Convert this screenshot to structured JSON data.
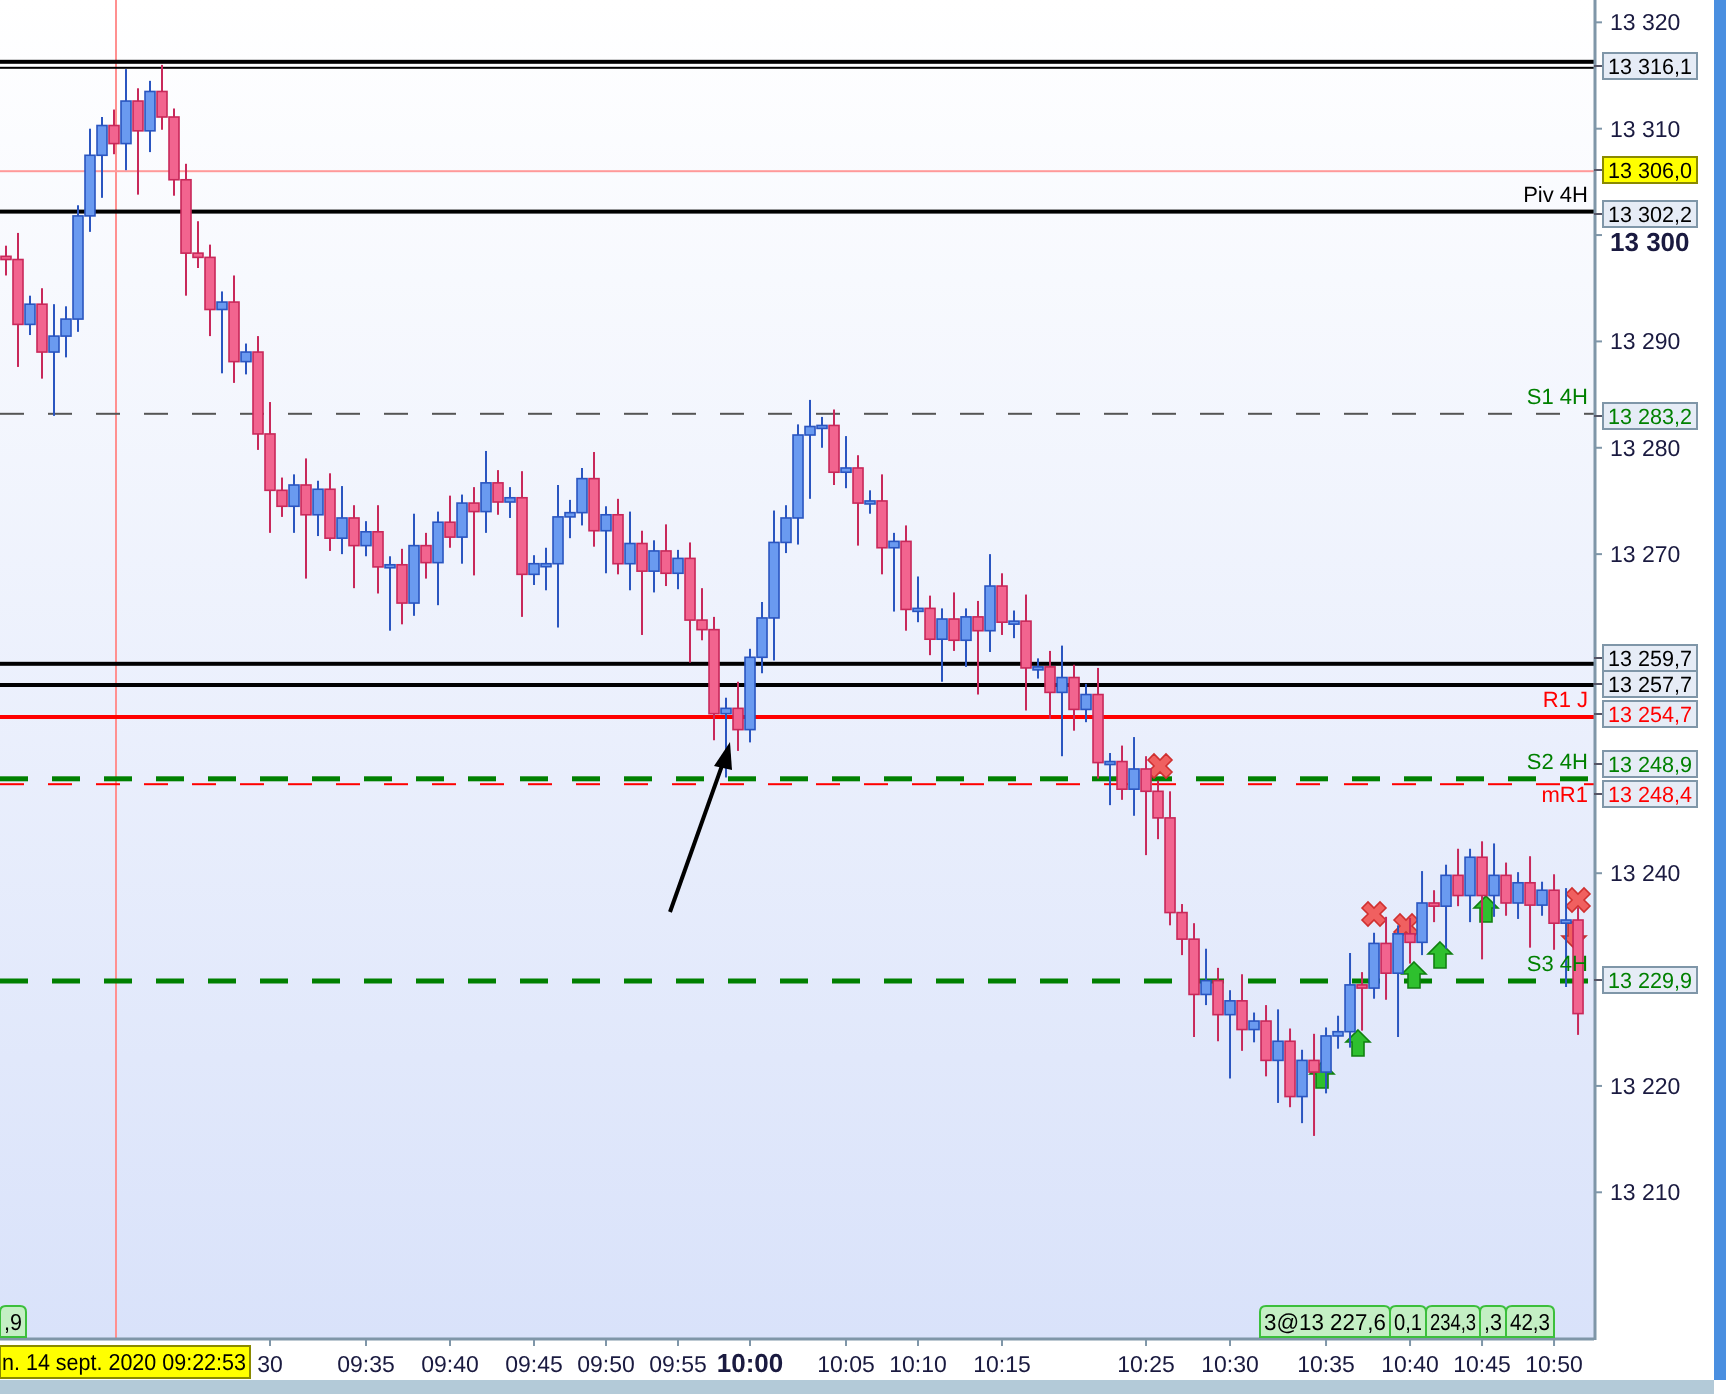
{
  "chart_data": {
    "type": "candlestick",
    "ylim": [
      13196.3,
      13322.1
    ],
    "yticks": [
      {
        "value": 13320,
        "label": "13 320"
      },
      {
        "value": 13310,
        "label": "13 310"
      },
      {
        "value": 13300,
        "label": "13 300"
      },
      {
        "value": 13290,
        "label": "13 290"
      },
      {
        "value": 13280,
        "label": "13 280"
      },
      {
        "value": 13270,
        "label": "13 270"
      },
      {
        "value": 13240,
        "label": "13 240"
      },
      {
        "value": 13220,
        "label": "13 220"
      },
      {
        "value": 13210,
        "label": "13 210"
      }
    ],
    "categories": [
      null,
      null,
      null,
      null,
      null,
      null,
      null,
      null,
      null,
      null,
      null,
      null,
      null,
      null,
      null,
      null,
      null,
      null,
      null,
      null,
      null,
      null,
      "30",
      null,
      null,
      null,
      null,
      null,
      null,
      null,
      "09:35",
      null,
      null,
      null,
      null,
      null,
      null,
      "09:40",
      null,
      null,
      null,
      null,
      null,
      null,
      "09:45",
      null,
      null,
      null,
      null,
      null,
      "09:50",
      null,
      null,
      null,
      null,
      null,
      "09:55",
      null,
      null,
      null,
      null,
      null,
      "10:00",
      null,
      null,
      null,
      null,
      null,
      null,
      null,
      "10:05",
      null,
      null,
      null,
      null,
      null,
      "10:10",
      null,
      null,
      null,
      null,
      null,
      null,
      "10:15",
      null,
      null,
      null,
      null,
      null,
      null,
      null,
      null,
      null,
      null,
      null,
      "10:25",
      null,
      null,
      null,
      null,
      null,
      null,
      "10:30",
      null,
      null,
      null,
      null,
      null,
      null,
      null,
      "10:35",
      null,
      null,
      null,
      null,
      null,
      null,
      "10:40",
      null,
      null,
      null,
      null,
      null,
      "10:45",
      null,
      null,
      null,
      null,
      null,
      "10:50",
      null,
      null
    ],
    "ohlc": [
      [
        13298,
        13299,
        13296.2,
        13297.7
      ],
      [
        13297.7,
        13300.2,
        13287.6,
        13291.6
      ],
      [
        13291.6,
        13294.3,
        13290.6,
        13293.5
      ],
      [
        13293.5,
        13295,
        13286.5,
        13289
      ],
      [
        13289,
        13293.5,
        13283,
        13290.5
      ],
      [
        13290.5,
        13293.3,
        13288.5,
        13292.1
      ],
      [
        13292.1,
        13302.8,
        13290.9,
        13301.8
      ],
      [
        13301.8,
        13310,
        13300.3,
        13307.5
      ],
      [
        13307.5,
        13311.1,
        13303.5,
        13310.3
      ],
      [
        13310.3,
        13311.8,
        13307.6,
        13308.6
      ],
      [
        13308.6,
        13315.6,
        13306.1,
        13312.6
      ],
      [
        13312.6,
        13313.8,
        13303.8,
        13309.8
      ],
      [
        13309.8,
        13314.5,
        13307.8,
        13313.5
      ],
      [
        13313.5,
        13316,
        13309.9,
        13311.1
      ],
      [
        13311.1,
        13311.9,
        13303.7,
        13305.2
      ],
      [
        13305.2,
        13306.7,
        13294.3,
        13298.3
      ],
      [
        13298.3,
        13301.3,
        13296.9,
        13297.9
      ],
      [
        13297.9,
        13299.1,
        13290.5,
        13293
      ],
      [
        13293,
        13294.7,
        13287,
        13293.7
      ],
      [
        13293.7,
        13296.2,
        13286.1,
        13288.1
      ],
      [
        13288.1,
        13289.8,
        13286.9,
        13289
      ],
      [
        13289,
        13290.5,
        13279.8,
        13281.3
      ],
      [
        13281.3,
        13284.3,
        13272,
        13276
      ],
      [
        13276,
        13277.2,
        13273.5,
        13274.5
      ],
      [
        13274.5,
        13277.5,
        13272,
        13276.5
      ],
      [
        13276.5,
        13279,
        13267.7,
        13273.7
      ],
      [
        13273.7,
        13276.9,
        13271.7,
        13276.1
      ],
      [
        13276.1,
        13277.6,
        13270.3,
        13271.5
      ],
      [
        13271.5,
        13276.4,
        13270,
        13273.4
      ],
      [
        13273.4,
        13274.6,
        13266.8,
        13270.8
      ],
      [
        13270.8,
        13273.1,
        13269.8,
        13272.1
      ],
      [
        13272.1,
        13274.6,
        13266.3,
        13268.8
      ],
      [
        13268.8,
        13269.8,
        13262.8,
        13269
      ],
      [
        13269,
        13270.5,
        13263.4,
        13265.4
      ],
      [
        13265.4,
        13273.8,
        13264.2,
        13270.8
      ],
      [
        13270.8,
        13272,
        13267.7,
        13269.2
      ],
      [
        13269.2,
        13274,
        13265.2,
        13273
      ],
      [
        13273,
        13275.5,
        13270.6,
        13271.6
      ],
      [
        13271.6,
        13275.6,
        13269.1,
        13274.8
      ],
      [
        13274.8,
        13276.3,
        13268,
        13274
      ],
      [
        13274,
        13279.7,
        13272,
        13276.7
      ],
      [
        13276.7,
        13277.9,
        13273.7,
        13274.9
      ],
      [
        13274.9,
        13276.3,
        13273.4,
        13275.3
      ],
      [
        13275.3,
        13277.8,
        13264.1,
        13268.1
      ],
      [
        13268.1,
        13269.9,
        13267.1,
        13269.1
      ],
      [
        13269.1,
        13270.6,
        13266.6,
        13269.1
      ],
      [
        13269.1,
        13276.5,
        13263.1,
        13273.5
      ],
      [
        13273.5,
        13275.1,
        13271.5,
        13273.9
      ],
      [
        13273.9,
        13278.1,
        13272.7,
        13277.1
      ],
      [
        13277.1,
        13279.6,
        13270.7,
        13272.2
      ],
      [
        13272.2,
        13274.5,
        13268.2,
        13273.7
      ],
      [
        13273.7,
        13275.2,
        13268.1,
        13269.1
      ],
      [
        13269.1,
        13274,
        13266.6,
        13271
      ],
      [
        13271,
        13272.2,
        13262.4,
        13268.4
      ],
      [
        13268.4,
        13271.3,
        13266.4,
        13270.3
      ],
      [
        13270.3,
        13272.8,
        13267,
        13268.2
      ],
      [
        13268.2,
        13270.4,
        13266.7,
        13269.6
      ],
      [
        13269.6,
        13271.1,
        13259.8,
        13263.8
      ],
      [
        13263.8,
        13266.8,
        13261.9,
        13262.9
      ],
      [
        13262.9,
        13264.1,
        13252.5,
        13255
      ],
      [
        13255,
        13256.5,
        13249,
        13255.5
      ],
      [
        13255.5,
        13258,
        13251.5,
        13253.5
      ],
      [
        13253.5,
        13261.1,
        13252.3,
        13260.3
      ],
      [
        13260.3,
        13265.5,
        13258.8,
        13264
      ],
      [
        13264,
        13274.1,
        13260,
        13271.1
      ],
      [
        13271.1,
        13274.6,
        13270.1,
        13273.4
      ],
      [
        13273.4,
        13282.2,
        13270.9,
        13281.2
      ],
      [
        13281.2,
        13284.5,
        13275.2,
        13282
      ],
      [
        13282,
        13282.9,
        13280,
        13282.1
      ],
      [
        13282.1,
        13283.6,
        13276.5,
        13277.7
      ],
      [
        13277.7,
        13281.1,
        13276.2,
        13278.1
      ],
      [
        13278.1,
        13279.3,
        13270.8,
        13274.8
      ],
      [
        13274.8,
        13276,
        13273.8,
        13275
      ],
      [
        13275,
        13277.5,
        13268.1,
        13270.6
      ],
      [
        13270.6,
        13272,
        13264.6,
        13271.2
      ],
      [
        13271.2,
        13272.7,
        13262.8,
        13264.8
      ],
      [
        13264.8,
        13267.9,
        13263.6,
        13264.9
      ],
      [
        13264.9,
        13266.1,
        13260.5,
        13262
      ],
      [
        13262,
        13264.9,
        13258,
        13263.9
      ],
      [
        13263.9,
        13266.4,
        13260.9,
        13261.9
      ],
      [
        13261.9,
        13264.9,
        13259.4,
        13264.1
      ],
      [
        13264.1,
        13265.6,
        13256.8,
        13262.8
      ],
      [
        13262.8,
        13270,
        13260.8,
        13267
      ],
      [
        13267,
        13268.2,
        13262.4,
        13263.6
      ],
      [
        13263.6,
        13264.7,
        13262.1,
        13263.7
      ],
      [
        13263.7,
        13266.2,
        13255.3,
        13259.3
      ],
      [
        13259.3,
        13260.2,
        13258.3,
        13259.4
      ],
      [
        13259.4,
        13260.9,
        13254.5,
        13257
      ],
      [
        13257,
        13261.4,
        13251,
        13258.4
      ],
      [
        13258.4,
        13259.6,
        13253.4,
        13255.4
      ],
      [
        13255.4,
        13257.8,
        13254.2,
        13256.8
      ],
      [
        13256.8,
        13259.3,
        13248.9,
        13250.4
      ],
      [
        13250.4,
        13251.3,
        13246.4,
        13250.5
      ],
      [
        13250.5,
        13252,
        13246.9,
        13247.9
      ],
      [
        13247.9,
        13252.8,
        13245.4,
        13249.8
      ],
      [
        13249.8,
        13251,
        13241.7,
        13247.7
      ],
      [
        13247.7,
        13248.7,
        13243.2,
        13245.2
      ],
      [
        13245.2,
        13247.7,
        13235.1,
        13236.3
      ],
      [
        13236.3,
        13237.1,
        13232.3,
        13233.8
      ],
      [
        13233.8,
        13235.3,
        13224.6,
        13228.6
      ],
      [
        13228.6,
        13232.9,
        13227.6,
        13229.9
      ],
      [
        13229.9,
        13231.1,
        13224.2,
        13226.7
      ],
      [
        13226.7,
        13229,
        13220.7,
        13228
      ],
      [
        13228,
        13230.5,
        13223.3,
        13225.3
      ],
      [
        13225.3,
        13226.9,
        13224.1,
        13226.1
      ],
      [
        13226.1,
        13227.6,
        13220.9,
        13222.4
      ],
      [
        13222.4,
        13227.2,
        13218.4,
        13224.2
      ],
      [
        13224.2,
        13225.4,
        13218,
        13219
      ],
      [
        13219,
        13223.4,
        13216.5,
        13222.4
      ],
      [
        13222.4,
        13224.9,
        13215.3,
        13221.3
      ],
      [
        13221.3,
        13225.5,
        13219.3,
        13224.7
      ],
      [
        13224.7,
        13226.6,
        13223.5,
        13225.1
      ],
      [
        13225.1,
        13232.5,
        13223.6,
        13229.5
      ],
      [
        13229.5,
        13230.7,
        13225.2,
        13229.2
      ],
      [
        13229.2,
        13234.4,
        13228.2,
        13233.4
      ],
      [
        13233.4,
        13235.9,
        13228.1,
        13230.6
      ],
      [
        13230.6,
        13235.1,
        13224.6,
        13234.3
      ],
      [
        13234.3,
        13235.8,
        13231.5,
        13233.5
      ],
      [
        13233.5,
        13240.2,
        13232.3,
        13237.2
      ],
      [
        13237.2,
        13238.4,
        13235.4,
        13236.9
      ],
      [
        13236.9,
        13240.8,
        13232.9,
        13239.8
      ],
      [
        13239.8,
        13242.3,
        13236.9,
        13237.9
      ],
      [
        13237.9,
        13242.3,
        13235.4,
        13241.5
      ],
      [
        13241.5,
        13243,
        13231.9,
        13237.9
      ],
      [
        13237.9,
        13242.8,
        13235.9,
        13239.8
      ],
      [
        13239.8,
        13241,
        13236,
        13237.2
      ],
      [
        13237.2,
        13240.1,
        13235.7,
        13239.1
      ],
      [
        13239.1,
        13241.6,
        13233,
        13237
      ],
      [
        13237,
        13239.2,
        13236,
        13238.4
      ],
      [
        13238.4,
        13239.9,
        13232.8,
        13235.3
      ],
      [
        13235.3,
        13238.6,
        13229.3,
        13235.6
      ],
      [
        13235.6,
        13236.8,
        13224.8,
        13226.8
      ]
    ]
  },
  "levels": [
    {
      "value": "13 316,1",
      "line": {
        "kind": "double",
        "color": "#000000"
      },
      "color": "#000000",
      "highlight": false
    },
    {
      "value": "13 306,0",
      "line": {
        "kind": "thin",
        "color": "#ff9999"
      },
      "color": "#000000",
      "highlight": true
    },
    {
      "value": "13 302,2",
      "line": {
        "kind": "solid",
        "color": "#000000"
      },
      "color": "#000000",
      "highlight": false,
      "caption": "Piv 4H"
    },
    {
      "value": "13 283,2",
      "line": {
        "kind": "dashed",
        "color": "#555555"
      },
      "color": "#008000",
      "highlight": false,
      "caption": "S1 4H"
    },
    {
      "value": "13 259,7",
      "line": {
        "kind": "solid",
        "color": "#000000"
      },
      "color": "#000000",
      "highlight": false
    },
    {
      "value": "13 257,7",
      "line": {
        "kind": "solid",
        "color": "#000000"
      },
      "color": "#000000",
      "highlight": false
    },
    {
      "value": "13 254,7",
      "line": {
        "kind": "solid",
        "color": "#ff0000"
      },
      "color": "#ff0000",
      "highlight": false,
      "caption": "R1 J"
    },
    {
      "value": "13 248,9",
      "line": {
        "kind": "bolddashed",
        "color": "#008000"
      },
      "color": "#008000",
      "highlight": false,
      "caption": "S2 4H"
    },
    {
      "value": "13 248,4",
      "line": {
        "kind": "dashed",
        "color": "#ff0000"
      },
      "color": "#ff0000",
      "highlight": false,
      "caption": "mR1"
    },
    {
      "value": "13 229,9",
      "line": {
        "kind": "bolddashed",
        "color": "#008000"
      },
      "color": "#008000",
      "highlight": false,
      "caption": "S3 4H"
    }
  ],
  "axis_styles": {
    "y_major": [
      false,
      false,
      true,
      false,
      false,
      false,
      false,
      false,
      false
    ],
    "x_major": [
      false,
      false,
      false,
      false,
      false,
      false,
      true,
      false,
      false,
      false,
      false,
      false,
      false,
      false,
      false,
      false
    ]
  },
  "cursor": {
    "time_tag": "n. 14 sept. 2020 09:22:53"
  },
  "trade_tags": [
    ",9",
    "3@13 227,6",
    "0,1",
    "234,3",
    ",3",
    "42,3"
  ],
  "signals": [
    {
      "kind": "exit"
    },
    {
      "kind": "exit"
    },
    {
      "kind": "exit"
    },
    {
      "kind": "exit"
    },
    {
      "kind": "buy"
    },
    {
      "kind": "buy"
    },
    {
      "kind": "buy"
    },
    {
      "kind": "buy"
    },
    {
      "kind": "buy"
    },
    {
      "kind": "sell"
    }
  ]
}
